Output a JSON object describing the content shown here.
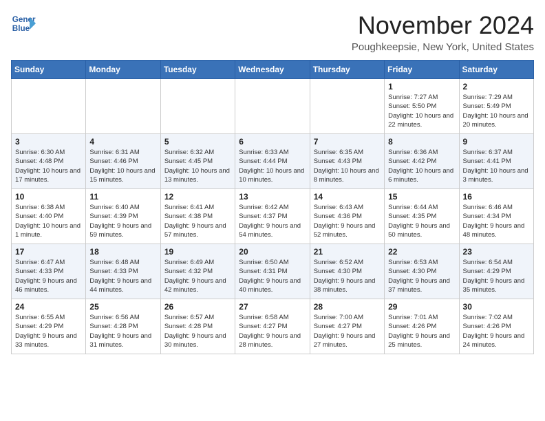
{
  "header": {
    "logo_line1": "General",
    "logo_line2": "Blue",
    "month": "November 2024",
    "location": "Poughkeepsie, New York, United States"
  },
  "weekdays": [
    "Sunday",
    "Monday",
    "Tuesday",
    "Wednesday",
    "Thursday",
    "Friday",
    "Saturday"
  ],
  "weeks": [
    [
      {
        "day": "",
        "info": ""
      },
      {
        "day": "",
        "info": ""
      },
      {
        "day": "",
        "info": ""
      },
      {
        "day": "",
        "info": ""
      },
      {
        "day": "",
        "info": ""
      },
      {
        "day": "1",
        "info": "Sunrise: 7:27 AM\nSunset: 5:50 PM\nDaylight: 10 hours and 22 minutes."
      },
      {
        "day": "2",
        "info": "Sunrise: 7:29 AM\nSunset: 5:49 PM\nDaylight: 10 hours and 20 minutes."
      }
    ],
    [
      {
        "day": "3",
        "info": "Sunrise: 6:30 AM\nSunset: 4:48 PM\nDaylight: 10 hours and 17 minutes."
      },
      {
        "day": "4",
        "info": "Sunrise: 6:31 AM\nSunset: 4:46 PM\nDaylight: 10 hours and 15 minutes."
      },
      {
        "day": "5",
        "info": "Sunrise: 6:32 AM\nSunset: 4:45 PM\nDaylight: 10 hours and 13 minutes."
      },
      {
        "day": "6",
        "info": "Sunrise: 6:33 AM\nSunset: 4:44 PM\nDaylight: 10 hours and 10 minutes."
      },
      {
        "day": "7",
        "info": "Sunrise: 6:35 AM\nSunset: 4:43 PM\nDaylight: 10 hours and 8 minutes."
      },
      {
        "day": "8",
        "info": "Sunrise: 6:36 AM\nSunset: 4:42 PM\nDaylight: 10 hours and 6 minutes."
      },
      {
        "day": "9",
        "info": "Sunrise: 6:37 AM\nSunset: 4:41 PM\nDaylight: 10 hours and 3 minutes."
      }
    ],
    [
      {
        "day": "10",
        "info": "Sunrise: 6:38 AM\nSunset: 4:40 PM\nDaylight: 10 hours and 1 minute."
      },
      {
        "day": "11",
        "info": "Sunrise: 6:40 AM\nSunset: 4:39 PM\nDaylight: 9 hours and 59 minutes."
      },
      {
        "day": "12",
        "info": "Sunrise: 6:41 AM\nSunset: 4:38 PM\nDaylight: 9 hours and 57 minutes."
      },
      {
        "day": "13",
        "info": "Sunrise: 6:42 AM\nSunset: 4:37 PM\nDaylight: 9 hours and 54 minutes."
      },
      {
        "day": "14",
        "info": "Sunrise: 6:43 AM\nSunset: 4:36 PM\nDaylight: 9 hours and 52 minutes."
      },
      {
        "day": "15",
        "info": "Sunrise: 6:44 AM\nSunset: 4:35 PM\nDaylight: 9 hours and 50 minutes."
      },
      {
        "day": "16",
        "info": "Sunrise: 6:46 AM\nSunset: 4:34 PM\nDaylight: 9 hours and 48 minutes."
      }
    ],
    [
      {
        "day": "17",
        "info": "Sunrise: 6:47 AM\nSunset: 4:33 PM\nDaylight: 9 hours and 46 minutes."
      },
      {
        "day": "18",
        "info": "Sunrise: 6:48 AM\nSunset: 4:33 PM\nDaylight: 9 hours and 44 minutes."
      },
      {
        "day": "19",
        "info": "Sunrise: 6:49 AM\nSunset: 4:32 PM\nDaylight: 9 hours and 42 minutes."
      },
      {
        "day": "20",
        "info": "Sunrise: 6:50 AM\nSunset: 4:31 PM\nDaylight: 9 hours and 40 minutes."
      },
      {
        "day": "21",
        "info": "Sunrise: 6:52 AM\nSunset: 4:30 PM\nDaylight: 9 hours and 38 minutes."
      },
      {
        "day": "22",
        "info": "Sunrise: 6:53 AM\nSunset: 4:30 PM\nDaylight: 9 hours and 37 minutes."
      },
      {
        "day": "23",
        "info": "Sunrise: 6:54 AM\nSunset: 4:29 PM\nDaylight: 9 hours and 35 minutes."
      }
    ],
    [
      {
        "day": "24",
        "info": "Sunrise: 6:55 AM\nSunset: 4:29 PM\nDaylight: 9 hours and 33 minutes."
      },
      {
        "day": "25",
        "info": "Sunrise: 6:56 AM\nSunset: 4:28 PM\nDaylight: 9 hours and 31 minutes."
      },
      {
        "day": "26",
        "info": "Sunrise: 6:57 AM\nSunset: 4:28 PM\nDaylight: 9 hours and 30 minutes."
      },
      {
        "day": "27",
        "info": "Sunrise: 6:58 AM\nSunset: 4:27 PM\nDaylight: 9 hours and 28 minutes."
      },
      {
        "day": "28",
        "info": "Sunrise: 7:00 AM\nSunset: 4:27 PM\nDaylight: 9 hours and 27 minutes."
      },
      {
        "day": "29",
        "info": "Sunrise: 7:01 AM\nSunset: 4:26 PM\nDaylight: 9 hours and 25 minutes."
      },
      {
        "day": "30",
        "info": "Sunrise: 7:02 AM\nSunset: 4:26 PM\nDaylight: 9 hours and 24 minutes."
      }
    ]
  ]
}
